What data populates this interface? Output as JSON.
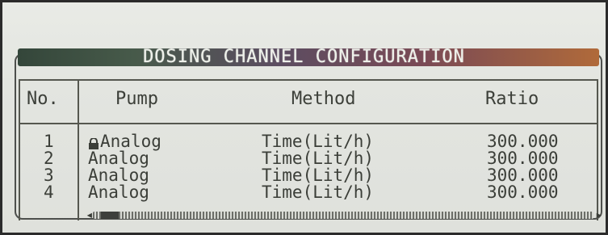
{
  "window": {
    "title": "DOSING CHANNEL CONFIGURATION"
  },
  "table": {
    "headers": [
      "No.",
      "Pump",
      "Method",
      "Ratio"
    ],
    "rows": [
      {
        "no": "1",
        "pump": "Analog",
        "method": "Time(Lit/h)",
        "ratio": "300.000"
      },
      {
        "no": "2",
        "pump": "Analog",
        "method": "Time(Lit/h)",
        "ratio": "300.000"
      },
      {
        "no": "3",
        "pump": "Analog",
        "method": "Time(Lit/h)",
        "ratio": "300.000"
      },
      {
        "no": "4",
        "pump": "Analog",
        "method": "Time(Lit/h)",
        "ratio": "300.000"
      }
    ]
  },
  "icons": {
    "lock": "lock-icon",
    "scroll_left": "scroll-left-arrow",
    "scroll_right": "scroll-right-arrow"
  },
  "colors": {
    "lcd_background": "#e3e5e0",
    "text": "#3b3e38",
    "title_bar_start": "#34463a",
    "title_bar_end": "#b06a3a"
  }
}
